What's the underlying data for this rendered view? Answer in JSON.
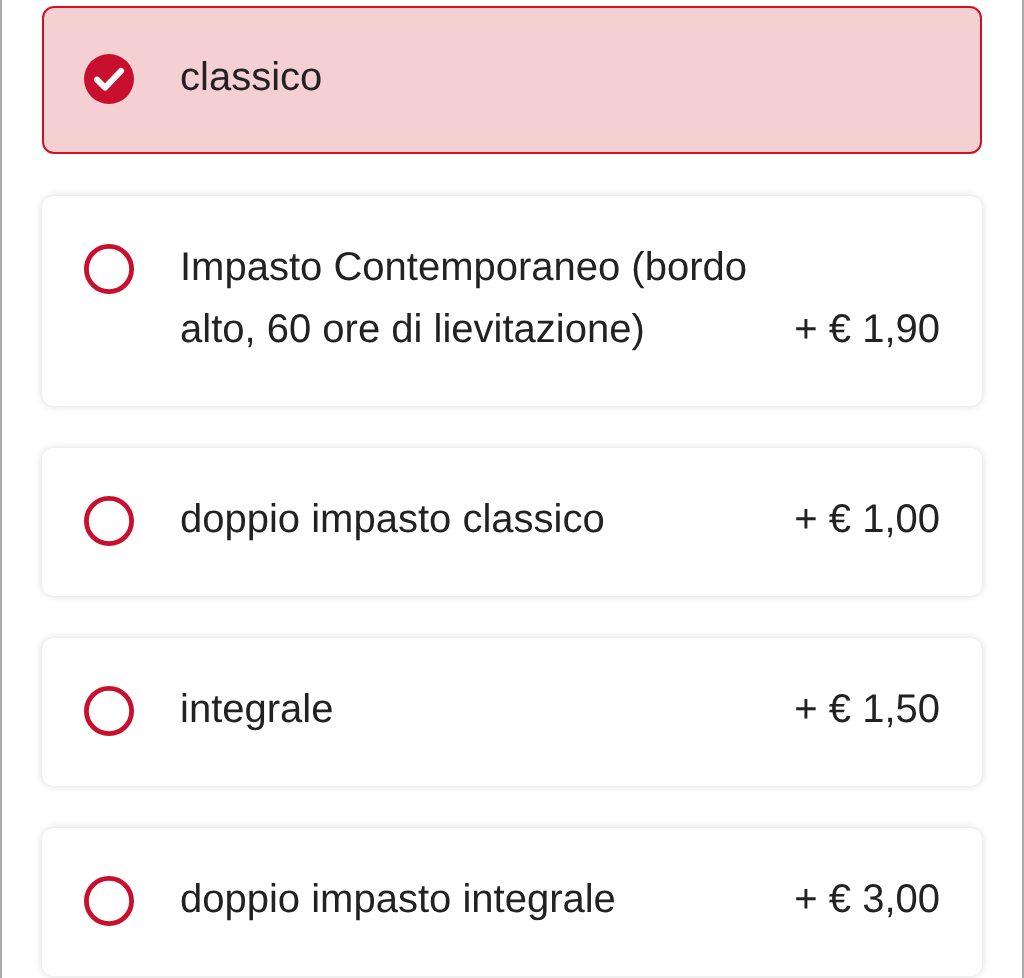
{
  "options": [
    {
      "label": "classico",
      "selected": true
    },
    {
      "label": "Impasto Contemporaneo (bordo alto, 60 ore di lievitazione)",
      "price": "+ € 1,90",
      "selected": false
    },
    {
      "label": "doppio impasto classico",
      "price": "+ € 1,00",
      "selected": false
    },
    {
      "label": "integrale",
      "price": "+ € 1,50",
      "selected": false
    },
    {
      "label": "doppio impasto integrale",
      "price": "+ € 3,00",
      "selected": false
    }
  ]
}
